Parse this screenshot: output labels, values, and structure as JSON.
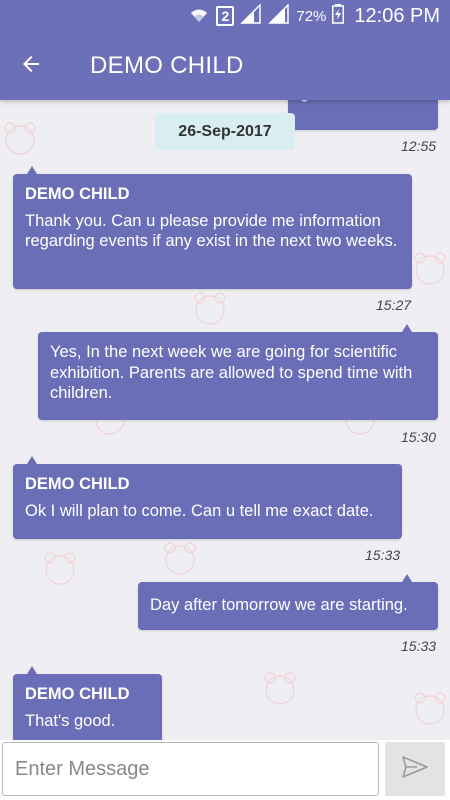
{
  "status_bar": {
    "sim_slot": "2",
    "battery_percent": "72%",
    "time": "12:06 PM",
    "icons": [
      "wifi-icon",
      "sim-icon",
      "signal-icon",
      "signal-icon",
      "battery-icon"
    ]
  },
  "app_bar": {
    "title": "DEMO CHILD",
    "back_icon": "arrow-left-icon"
  },
  "colors": {
    "primary": "#6c70b8",
    "bubble": "#6a6eb6",
    "date_chip": "#d8eef2",
    "background": "#efeef2"
  },
  "chat": {
    "partial_message": {
      "text": "good",
      "time": "12:55"
    },
    "date_separator": "26-Sep-2017",
    "messages": [
      {
        "direction": "incoming",
        "sender": "DEMO CHILD",
        "text": "Thank you. Can u please provide me information regarding events if any exist in the next two weeks.",
        "time": "15:27"
      },
      {
        "direction": "outgoing",
        "text": "Yes, In the next week we are going for scientific exhibition. Parents are allowed to spend time with children.",
        "time": "15:30"
      },
      {
        "direction": "incoming",
        "sender": "DEMO CHILD",
        "text": "Ok I will plan to come. Can u tell me exact date.",
        "time": "15:33"
      },
      {
        "direction": "outgoing",
        "text": "Day after tomorrow we are starting.",
        "time": "15:33"
      },
      {
        "direction": "incoming",
        "sender": "DEMO CHILD",
        "text": "That's good.",
        "time": ""
      }
    ]
  },
  "composer": {
    "placeholder": "Enter Message",
    "value": "",
    "send_icon": "send-icon"
  }
}
